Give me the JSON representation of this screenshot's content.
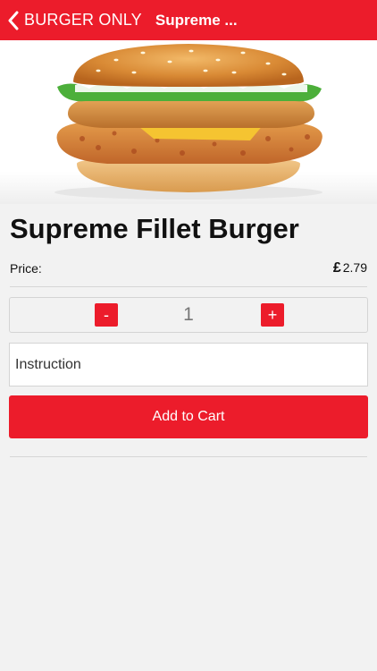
{
  "nav": {
    "back_label": "BURGER ONLY",
    "title": "Supreme ..."
  },
  "product": {
    "name": "Supreme Fillet Burger",
    "price_label": "Price:",
    "currency_symbol": "£",
    "price": "2.79"
  },
  "quantity": {
    "minus_label": "-",
    "value": "1",
    "plus_label": "+"
  },
  "instruction": {
    "placeholder": "Instruction"
  },
  "actions": {
    "add_to_cart": "Add to Cart"
  },
  "colors": {
    "accent": "#ec1c2b",
    "background": "#f2f2f2"
  },
  "icons": {
    "back": "chevron-left-icon"
  }
}
